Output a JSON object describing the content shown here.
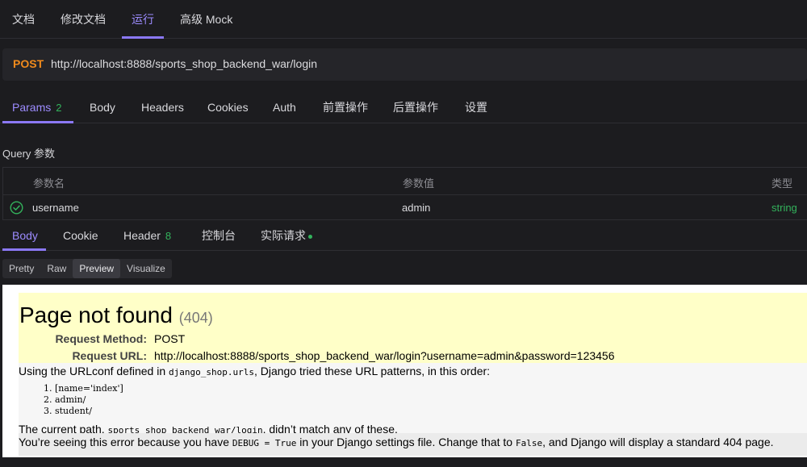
{
  "top_tabs": {
    "doc": "文档",
    "edit_doc": "修改文档",
    "run": "运行",
    "mock": "高级 Mock"
  },
  "request": {
    "method": "POST",
    "url": "http://localhost:8888/sports_shop_backend_war/login"
  },
  "request_tabs": {
    "params": "Params",
    "params_count": "2",
    "body": "Body",
    "headers": "Headers",
    "cookies": "Cookies",
    "auth": "Auth",
    "pre_ops": "前置操作",
    "post_ops": "后置操作",
    "settings": "设置"
  },
  "query": {
    "title": "Query 参数",
    "col_name": "参数名",
    "col_value": "参数值",
    "col_type": "类型",
    "rows": [
      {
        "name": "username",
        "value": "admin",
        "type": "string"
      }
    ]
  },
  "response_tabs": {
    "body": "Body",
    "cookie": "Cookie",
    "header": "Header",
    "header_count": "8",
    "console": "控制台",
    "actual_request": "实际请求"
  },
  "view_modes": {
    "pretty": "Pretty",
    "raw": "Raw",
    "preview": "Preview",
    "visualize": "Visualize"
  },
  "preview": {
    "title": "Page not found",
    "status": "(404)",
    "method_label": "Request Method:",
    "method_value": "POST",
    "url_label": "Request URL:",
    "url_value": "http://localhost:8888/sports_shop_backend_war/login?username=admin&password=123456",
    "urlconf_pre": "Using the URLconf defined in ",
    "urlconf_name": "django_shop.urls",
    "urlconf_post": ", Django tried these URL patterns, in this order:",
    "patterns": [
      "1.  [name='index']",
      "2.  admin/",
      "3.  student/"
    ],
    "current_pre": "The current path, ",
    "current_path": "sports_shop_backend_war/login",
    "current_post": ", didn’t match any of these.",
    "debug_pre": "You’re seeing this error because you have ",
    "debug_code": "DEBUG = True",
    "debug_mid": " in your Django settings file. Change that to ",
    "debug_false": "False",
    "debug_post": ", and Django will display a standard 404 page."
  },
  "colors": {
    "accent": "#8b78f6",
    "method": "#f08a1c",
    "success": "#33b35c",
    "summary_bg": "#ffffc8"
  }
}
